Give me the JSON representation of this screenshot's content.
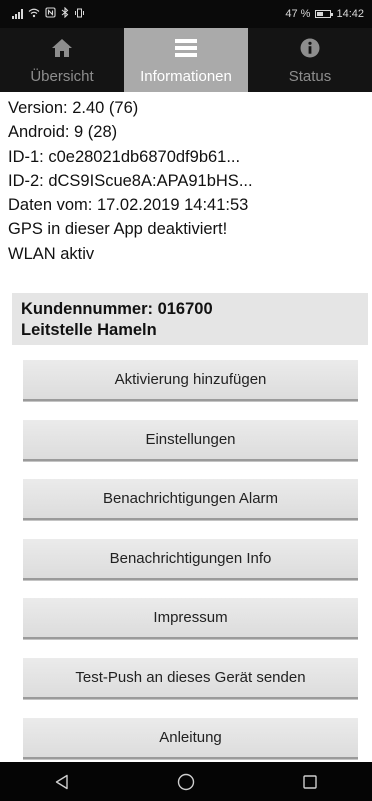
{
  "status_bar": {
    "left_icons": [
      "signal-icon",
      "wifi-icon",
      "nfc-icon",
      "bluetooth-icon",
      "vibrate-icon"
    ],
    "battery_percent": "47 %",
    "battery_level": 0.47,
    "time": "14:42"
  },
  "tabs": [
    {
      "label": "Übersicht",
      "icon": "home-icon",
      "active": false
    },
    {
      "label": "Informationen",
      "icon": "menu-icon",
      "active": true
    },
    {
      "label": "Status",
      "icon": "info-icon",
      "active": false
    }
  ],
  "info": {
    "version": "Version: 2.40  (76)",
    "android": "Android: 9  (28)",
    "id1": "ID-1: c0e28021db6870df9b61...",
    "id2": "ID-2: dCS9IScue8A:APA91bHS...",
    "date": "Daten vom: 17.02.2019  14:41:53",
    "gps": "GPS in dieser App deaktiviert!",
    "wlan": "WLAN aktiv"
  },
  "customer": {
    "number": "Kundennummer: 016700",
    "name": "Leitstelle Hameln"
  },
  "buttons": [
    "Aktivierung hinzufügen",
    "Einstellungen",
    "Benachrichtigungen Alarm",
    "Benachrichtigungen Info",
    "Impressum",
    "Test-Push an dieses Gerät senden",
    "Anleitung"
  ],
  "nav": [
    "back-icon",
    "home-circle-icon",
    "recents-icon"
  ],
  "colors": {
    "tab_bar": "#141414",
    "tab_active": "#aaaaaa",
    "customer_box": "#e5e5e5",
    "button_face": "#e3e3e3"
  }
}
